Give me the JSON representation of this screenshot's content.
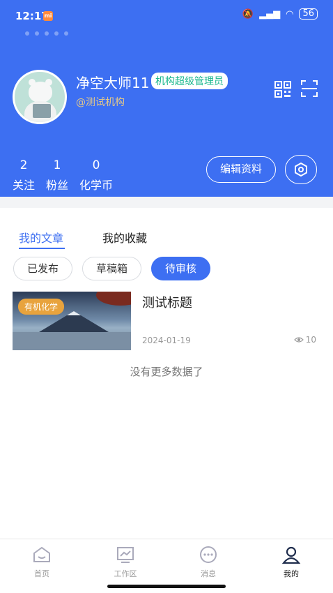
{
  "status_bar": {
    "time": "12:17",
    "battery": "56"
  },
  "profile": {
    "username": "净空大师11",
    "role": "机构超级管理员",
    "org": "@测试机构",
    "stats": [
      {
        "num": "2",
        "label": "关注"
      },
      {
        "num": "1",
        "label": "粉丝"
      },
      {
        "num": "0",
        "label": "化学币"
      }
    ],
    "edit_label": "编辑资料"
  },
  "tabs": {
    "articles": "我的文章",
    "favorites": "我的收藏"
  },
  "filters": {
    "published": "已发布",
    "drafts": "草稿箱",
    "pending": "待审核"
  },
  "articles": [
    {
      "tag": "有机化学",
      "title": "测试标题",
      "date": "2024-01-19",
      "views": "10"
    }
  ],
  "no_more_text": "没有更多数据了",
  "tabbar": [
    {
      "label": "首页",
      "icon": "home-icon"
    },
    {
      "label": "工作区",
      "icon": "workspace-icon"
    },
    {
      "label": "消息",
      "icon": "message-icon"
    },
    {
      "label": "我的",
      "icon": "profile-icon"
    }
  ],
  "colors": {
    "primary": "#3d6ff2",
    "role_badge_text": "#1db88f",
    "tag": "#e8a33d",
    "org": "#e2c78a"
  }
}
